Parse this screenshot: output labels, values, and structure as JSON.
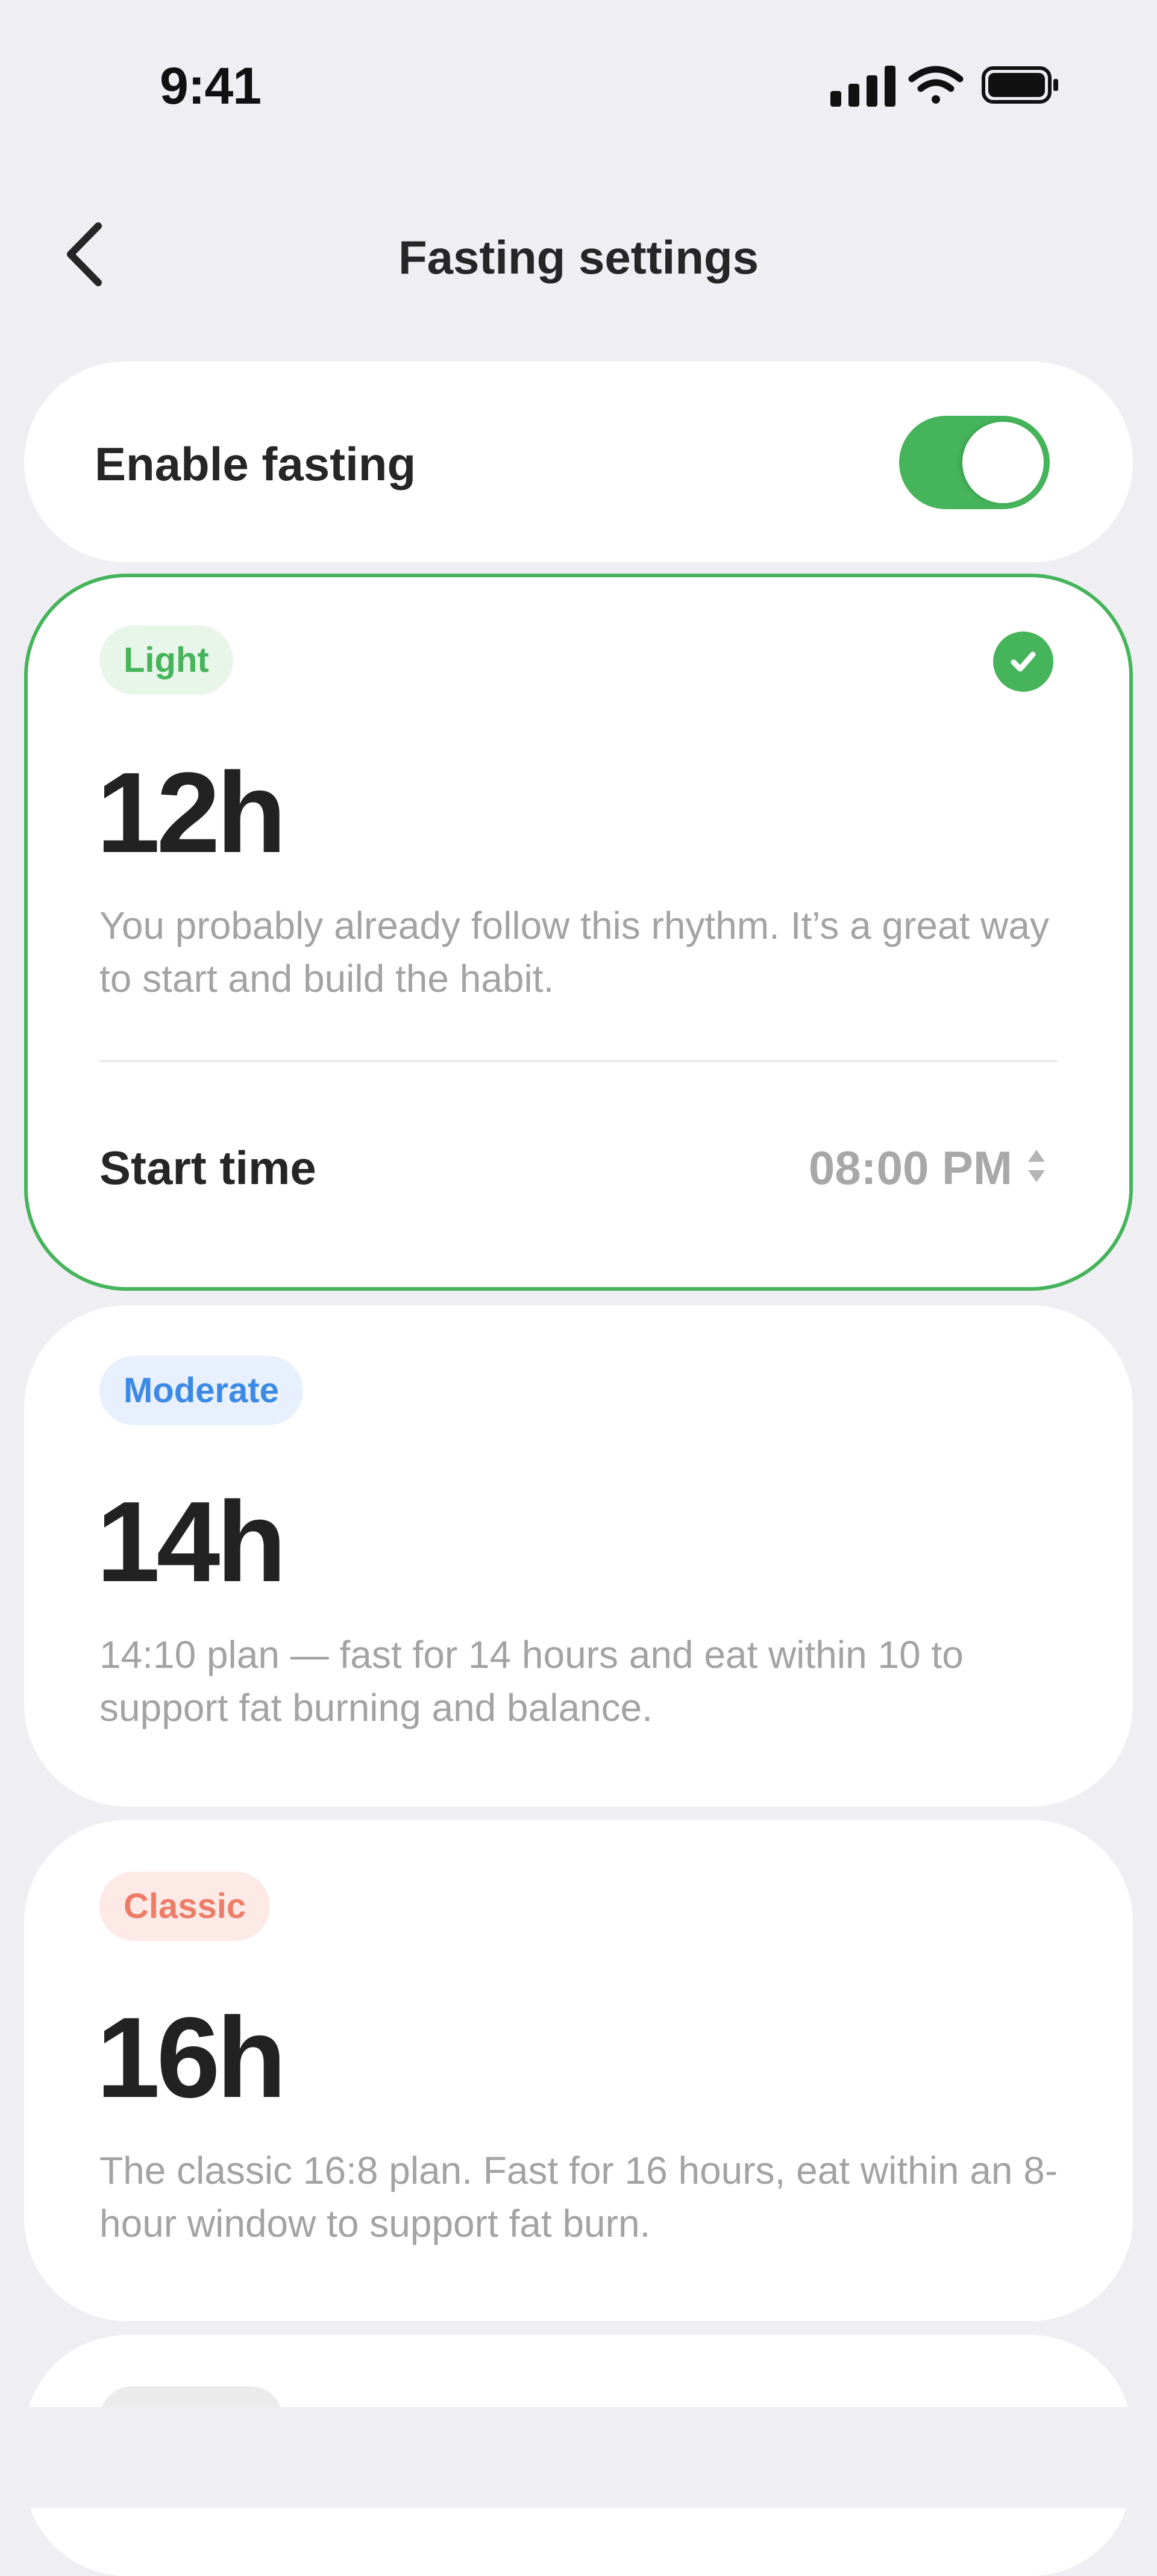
{
  "status_bar": {
    "time": "9:41",
    "icons": [
      "signal-icon",
      "wifi-icon",
      "battery-icon"
    ]
  },
  "header": {
    "title": "Fasting settings",
    "back_icon": "chevron-left-icon"
  },
  "enable_fasting": {
    "label": "Enable fasting",
    "enabled": true
  },
  "plans": [
    {
      "tag": "Light",
      "hours": "12h",
      "description": "You probably already follow this rhythm. It’s a great way to start and build the habit.",
      "selected": true,
      "start_time_label": "Start time",
      "start_time_value": "08:00 PM"
    },
    {
      "tag": "Moderate",
      "hours": "14h",
      "description": "14:10 plan — fast for 14 hours and eat within 10 to support fat burning and balance."
    },
    {
      "tag": "Classic",
      "hours": "16h",
      "description": "The classic 16:8 plan. Fast for 16 hours, eat within an 8-hour window to support fat burn."
    }
  ],
  "colors": {
    "background": "#EEEEF3",
    "accent_green": "#45B45A",
    "moderate_blue": "#3D8AE6",
    "classic_coral": "#EE7D68",
    "text_dark": "#262626",
    "text_muted": "#A3A3A3"
  }
}
